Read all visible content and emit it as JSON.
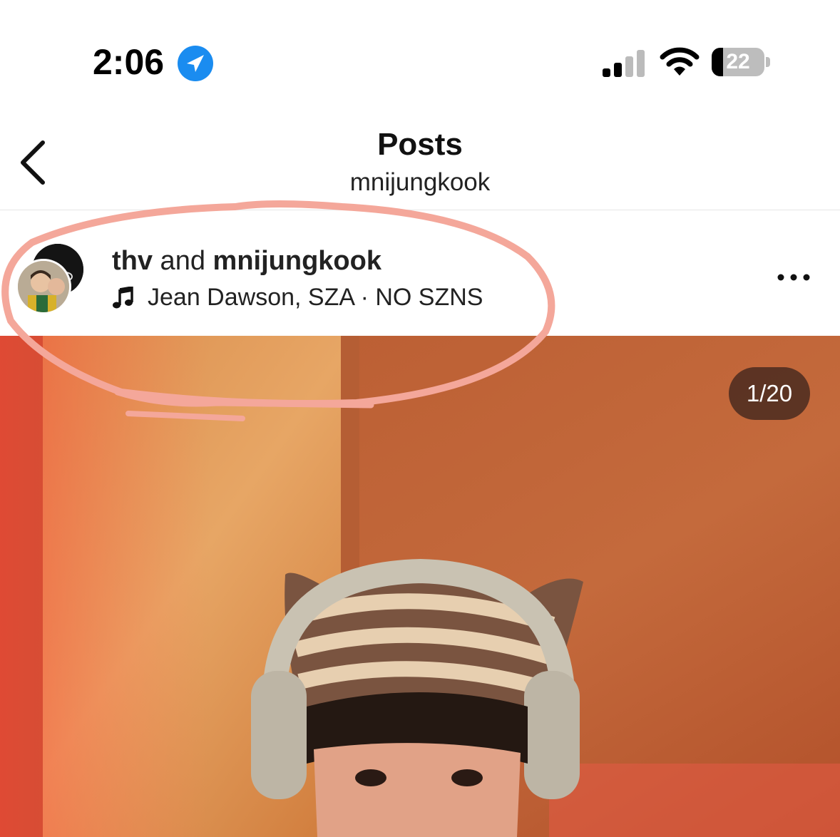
{
  "status_bar": {
    "time": "2:06",
    "battery_level": "22",
    "battery_fraction": 0.22,
    "icons": [
      "location-arrow-icon",
      "cellular-signal-icon",
      "wifi-icon",
      "battery-icon"
    ]
  },
  "header": {
    "title": "Posts",
    "subtitle": "mnijungkook",
    "back_icon": "chevron-left-icon"
  },
  "post": {
    "user_first": "thv",
    "joiner": " and ",
    "user_second": "mnijungkook",
    "music": "Jean Dawson, SZA · NO SZNS",
    "music_icon": "music-note-icon",
    "more_icon": "more-horizontal-icon",
    "counter": "1/20"
  },
  "colors": {
    "annotation_stroke": "#f4a79a",
    "badge_bg": "#4a2a20",
    "link_blue": "#1a8cf0"
  }
}
